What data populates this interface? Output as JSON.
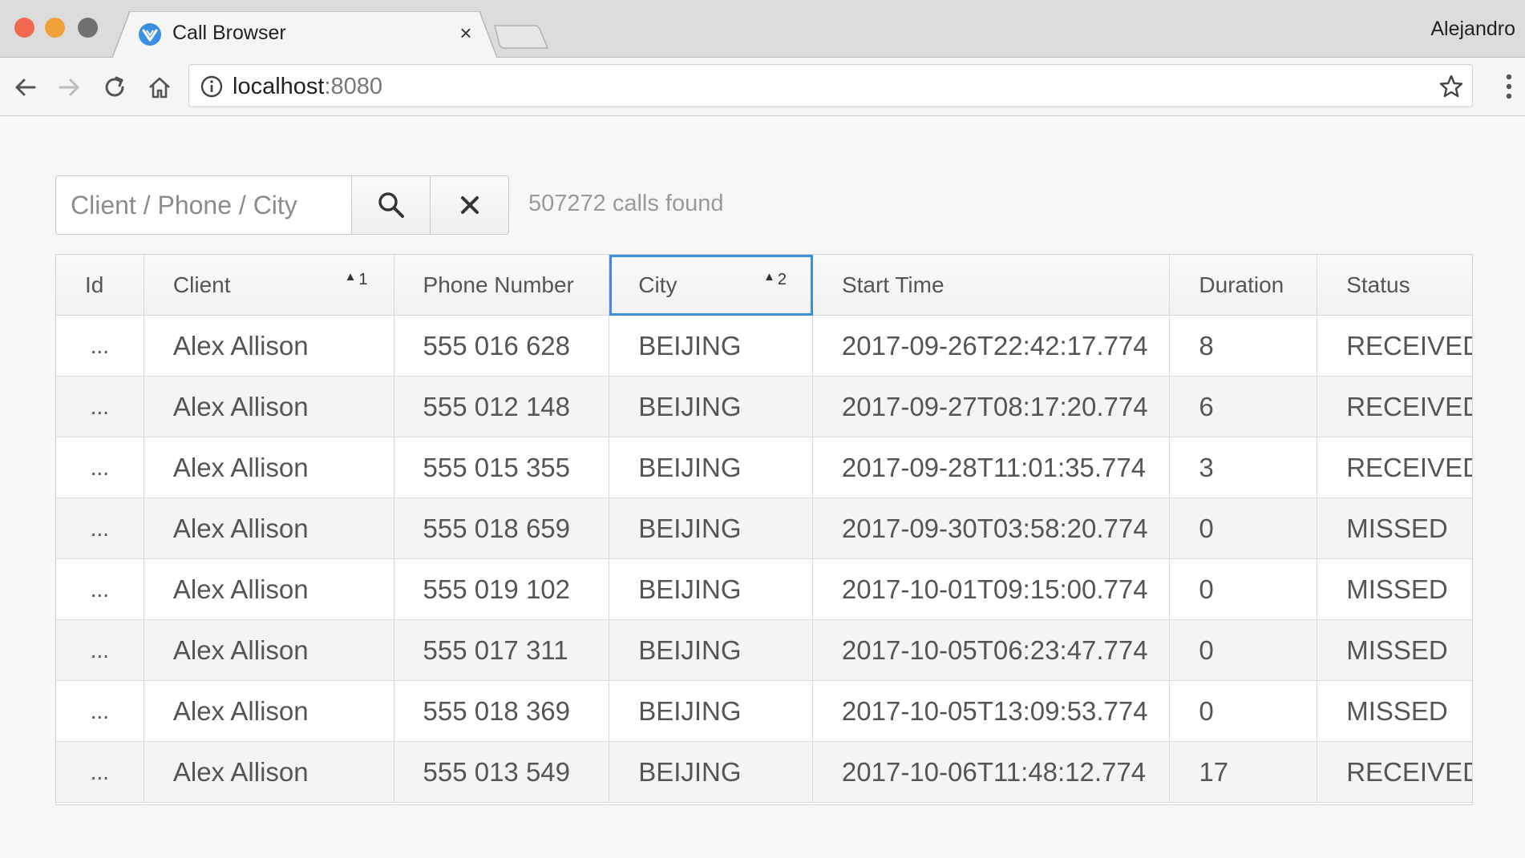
{
  "browser": {
    "tab_title": "Call Browser",
    "tab_close": "×",
    "profile_name": "Alejandro",
    "url_host": "localhost",
    "url_port": ":8080",
    "icons": [
      "back-icon",
      "forward-icon",
      "reload-icon",
      "home-icon",
      "info-icon",
      "star-icon",
      "menu-icon"
    ]
  },
  "search": {
    "placeholder": "Client / Phone / City",
    "value": "",
    "search_icon": "search-icon",
    "clear_icon": "close-icon"
  },
  "results_text": "507272 calls found",
  "grid": {
    "columns": [
      {
        "key": "id",
        "label": "Id"
      },
      {
        "key": "client",
        "label": "Client",
        "sort_order": "1",
        "sort_dir": "asc"
      },
      {
        "key": "phone",
        "label": "Phone Number"
      },
      {
        "key": "city",
        "label": "City",
        "sort_order": "2",
        "sort_dir": "asc",
        "focused": true
      },
      {
        "key": "start",
        "label": "Start Time"
      },
      {
        "key": "duration",
        "label": "Duration"
      },
      {
        "key": "status",
        "label": "Status"
      }
    ],
    "rows": [
      {
        "id": "...",
        "client": "Alex Allison",
        "phone": "555 016 628",
        "city": "BEIJING",
        "start": "2017-09-26T22:42:17.774",
        "duration": "8",
        "status": "RECEIVED"
      },
      {
        "id": "...",
        "client": "Alex Allison",
        "phone": "555 012 148",
        "city": "BEIJING",
        "start": "2017-09-27T08:17:20.774",
        "duration": "6",
        "status": "RECEIVED"
      },
      {
        "id": "...",
        "client": "Alex Allison",
        "phone": "555 015 355",
        "city": "BEIJING",
        "start": "2017-09-28T11:01:35.774",
        "duration": "3",
        "status": "RECEIVED"
      },
      {
        "id": "...",
        "client": "Alex Allison",
        "phone": "555 018 659",
        "city": "BEIJING",
        "start": "2017-09-30T03:58:20.774",
        "duration": "0",
        "status": "MISSED"
      },
      {
        "id": "...",
        "client": "Alex Allison",
        "phone": "555 019 102",
        "city": "BEIJING",
        "start": "2017-10-01T09:15:00.774",
        "duration": "0",
        "status": "MISSED"
      },
      {
        "id": "...",
        "client": "Alex Allison",
        "phone": "555 017 311",
        "city": "BEIJING",
        "start": "2017-10-05T06:23:47.774",
        "duration": "0",
        "status": "MISSED"
      },
      {
        "id": "...",
        "client": "Alex Allison",
        "phone": "555 018 369",
        "city": "BEIJING",
        "start": "2017-10-05T13:09:53.774",
        "duration": "0",
        "status": "MISSED"
      },
      {
        "id": "...",
        "client": "Alex Allison",
        "phone": "555 013 549",
        "city": "BEIJING",
        "start": "2017-10-06T11:48:12.774",
        "duration": "17",
        "status": "RECEIVED"
      }
    ]
  },
  "colors": {
    "focus_outline": "#3e8de0",
    "tab_icon": "#3b8fe3"
  }
}
